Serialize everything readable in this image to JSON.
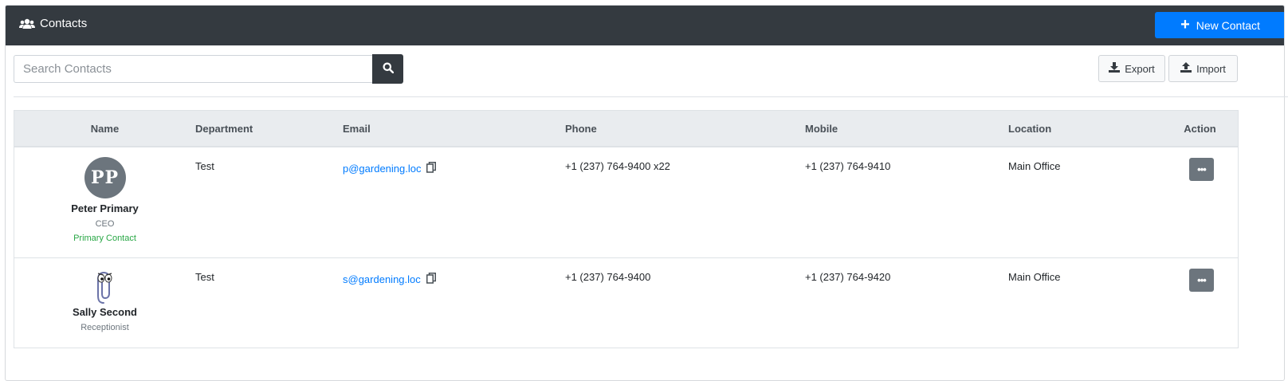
{
  "header": {
    "title": "Contacts",
    "new_contact_label": "New Contact"
  },
  "search": {
    "placeholder": "Search Contacts",
    "value": ""
  },
  "toolbar": {
    "export_label": "Export",
    "import_label": "Import"
  },
  "table": {
    "columns": [
      "Name",
      "Department",
      "Email",
      "Phone",
      "Mobile",
      "Location",
      "Action"
    ],
    "rows": [
      {
        "initials": "PP",
        "name": "Peter Primary",
        "title": "CEO",
        "tag": "Primary Contact",
        "department": "Test",
        "email": "p@gardening.loc",
        "phone": "+1 (237) 764-9400 x22",
        "mobile": "+1 (237) 764-9410",
        "location": "Main Office",
        "action_label": "•••"
      },
      {
        "avatar_icon": "paperclip-avatar-icon",
        "name": "Sally Second",
        "title": "Receptionist",
        "department": "Test",
        "email": "s@gardening.loc",
        "phone": "+1 (237) 764-9400",
        "mobile": "+1 (237) 764-9420",
        "location": "Main Office",
        "action_label": "•••"
      }
    ]
  },
  "colors": {
    "header_bg": "#343a40",
    "primary": "#007bff",
    "success": "#28a745",
    "secondary": "#6c757d"
  }
}
